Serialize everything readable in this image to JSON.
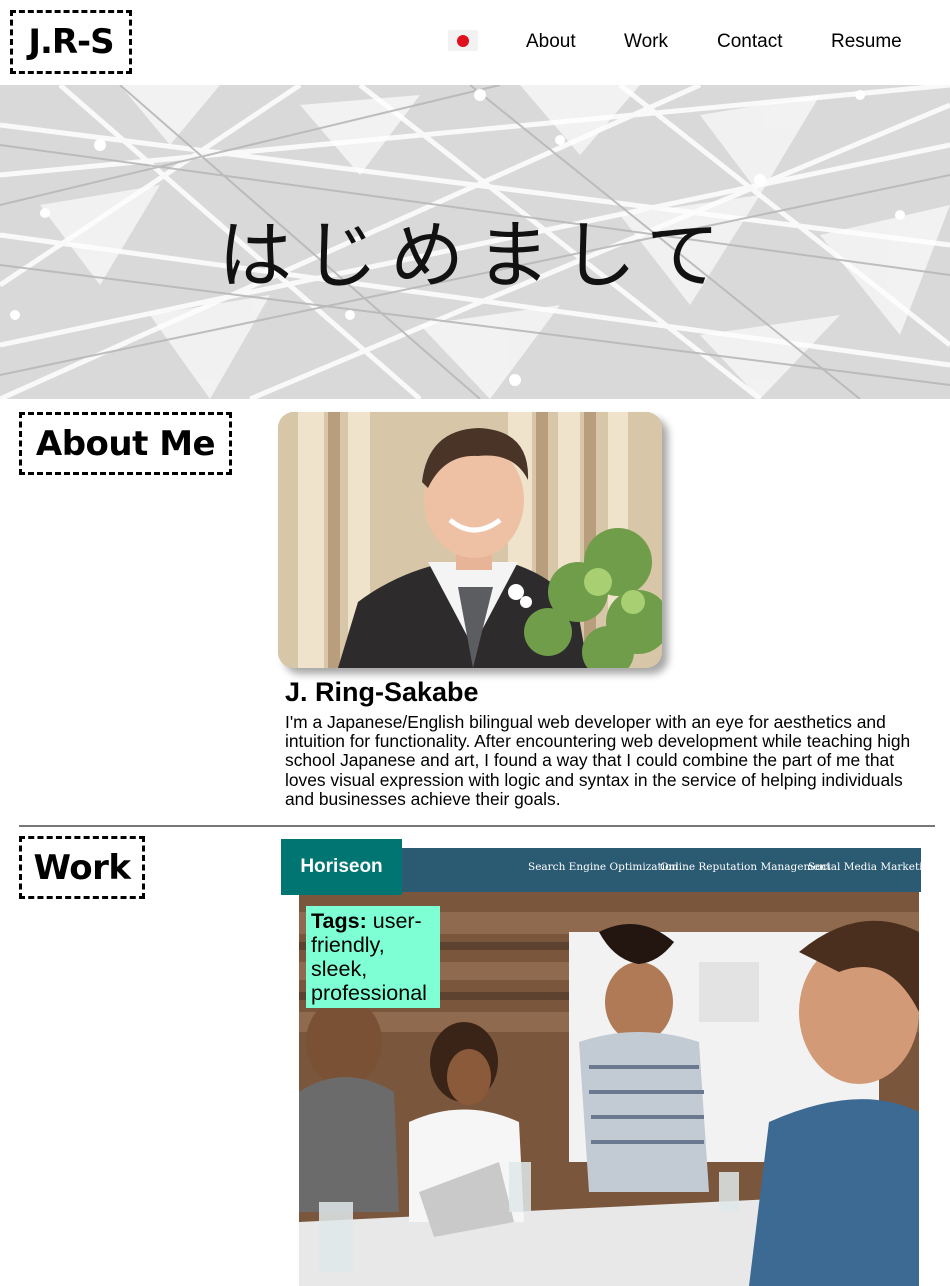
{
  "header": {
    "logo": "J.R-S",
    "language_toggle_icon": "japan-flag-icon",
    "nav": [
      "About",
      "Work",
      "Contact",
      "Resume"
    ]
  },
  "hero": {
    "title": "はじめまして"
  },
  "about": {
    "heading": "About Me",
    "name": "J. Ring-Sakabe",
    "bio": "I'm a Japanese/English bilingual web developer with an eye for aesthetics and intuition for functionality. After encountering web development while teaching high school Japanese and art, I found a way that I could combine the part of me that loves visual expression with logic and syntax in the service of helping individuals and businesses achieve their goals."
  },
  "work": {
    "heading": "Work",
    "projects": [
      {
        "title": "Horiseon",
        "screenshot_nav": [
          "Search Engine Optimization",
          "Online Reputation Management",
          "Social Media Marketing"
        ],
        "tags_label": "Tags:",
        "tags": "user-friendly, sleek, professional"
      }
    ]
  },
  "colors": {
    "project_title_bg": "#007571",
    "tags_bg": "#7fffd4",
    "site_bar_bg": "#2b5a73",
    "flag_red": "#e0101e"
  }
}
